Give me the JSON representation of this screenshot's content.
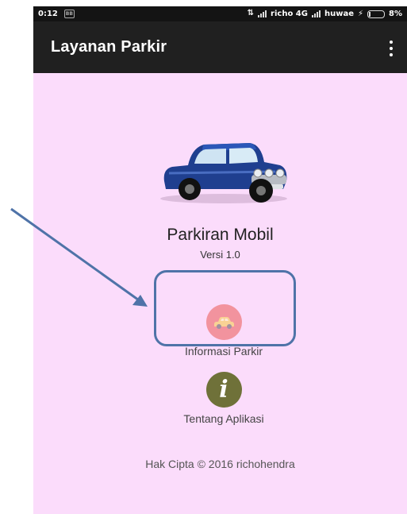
{
  "status_bar": {
    "time": "0:12",
    "notification_icon": "bbm-icon",
    "carrier1": "richo 4G",
    "carrier2": "huwae",
    "battery": "8%"
  },
  "app_bar": {
    "title": "Layanan Parkir",
    "menu_icon": "overflow-menu-icon"
  },
  "main": {
    "hero_icon": "car-illustration",
    "app_name": "Parkiran Mobil",
    "version": "Versi 1.0",
    "menu": [
      {
        "label": "Informasi Parkir",
        "icon": "car-icon",
        "color": "#e63b2e"
      },
      {
        "label": "Tentang Aplikasi",
        "icon": "info-icon",
        "color": "#6f7139"
      }
    ],
    "copyright": "Hak Cipta © 2016 richohendra"
  },
  "annotation": {
    "arrow_color": "#4f73a8",
    "box_color": "#4f73a8"
  },
  "colors": {
    "background": "#fbdcfb",
    "app_bar": "#202020",
    "status_bar": "#141414"
  }
}
